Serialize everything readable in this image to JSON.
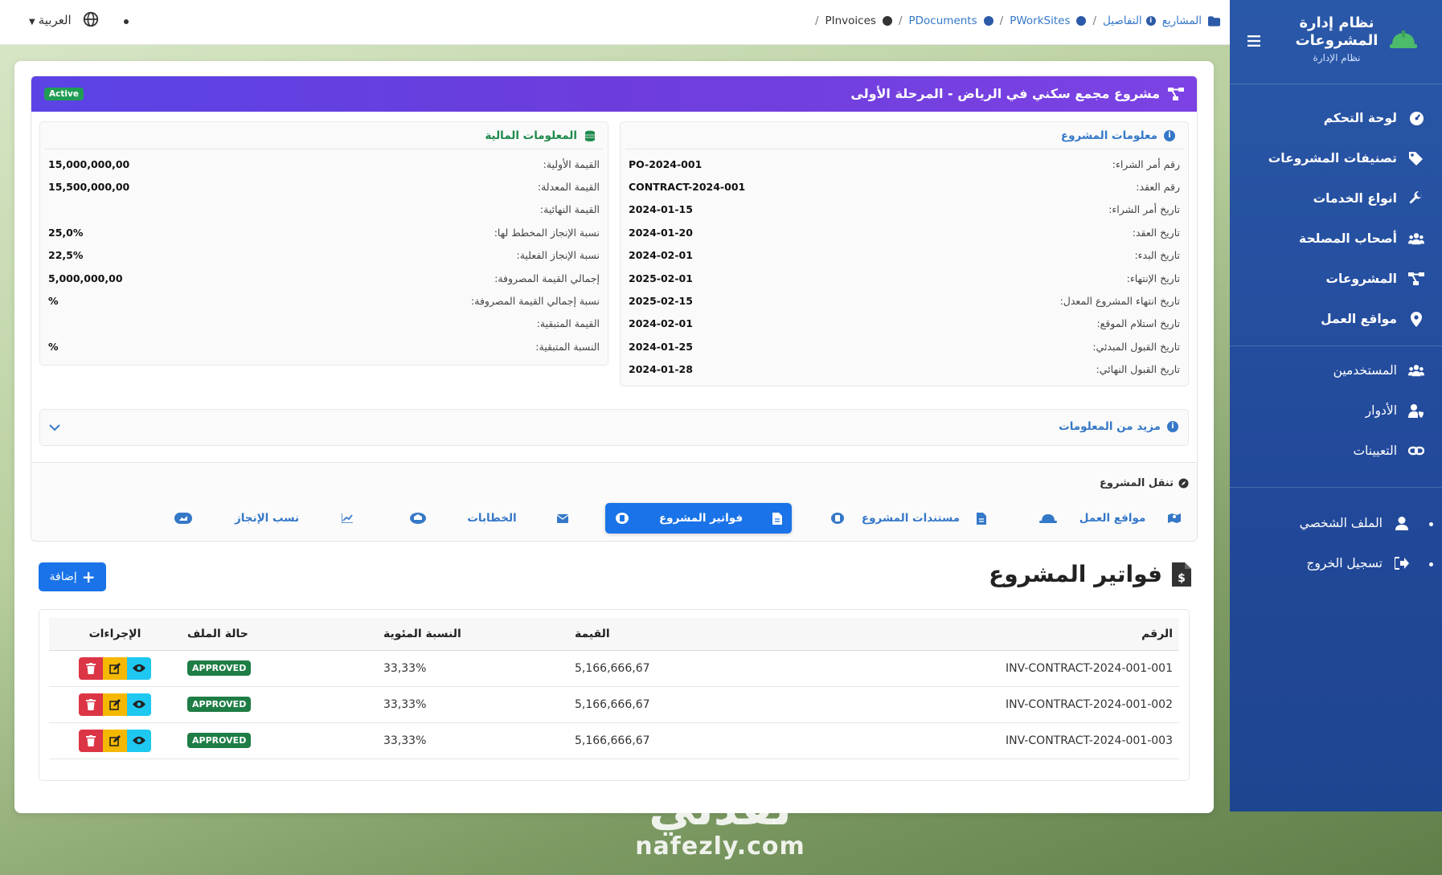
{
  "topbar": {
    "language": "العربية",
    "breadcrumb": [
      {
        "label": "المشاريع"
      },
      {
        "label": "التفاصيل"
      },
      {
        "label": "PWorkSites"
      },
      {
        "label": "PDocuments"
      },
      {
        "label": "PInvoices"
      }
    ]
  },
  "sidebar": {
    "brand_title_1": "نظام إدارة",
    "brand_title_2": "المشروعات",
    "brand_sub": "نظام الإدارة",
    "items": [
      {
        "label": "لوحة التحكم",
        "icon": "gauge-icon"
      },
      {
        "label": "تصنيفات المشروعات",
        "icon": "tags-icon"
      },
      {
        "label": "انواع الخدمات",
        "icon": "wrench-icon"
      },
      {
        "label": "أصحاب المصلحة",
        "icon": "users-icon"
      },
      {
        "label": "المشروعات",
        "icon": "project-diagram-icon"
      },
      {
        "label": "مواقع العمل",
        "icon": "map-pin-icon"
      },
      {
        "label": "المستخدمين",
        "icon": "users-icon"
      },
      {
        "label": "الأدوار",
        "icon": "user-shield-icon"
      },
      {
        "label": "التعيينات",
        "icon": "link-icon"
      }
    ],
    "profile": "الملف الشخصي",
    "logout": "تسجيل الخروج"
  },
  "project": {
    "title": "مشروع مجمع سكني في الرياض - المرحلة الأولى",
    "status": "Active",
    "info_header": "معلومات المشروع",
    "info": [
      {
        "k": "رقم أمر الشراء:",
        "v": "PO-2024-001"
      },
      {
        "k": "رقم العقد:",
        "v": "CONTRACT-2024-001"
      },
      {
        "k": "تاريخ أمر الشراء:",
        "v": "2024-01-15"
      },
      {
        "k": "تاريخ العقد:",
        "v": "2024-01-20"
      },
      {
        "k": "تاريخ البدء:",
        "v": "2024-02-01"
      },
      {
        "k": "تاريخ الإنتهاء:",
        "v": "2025-02-01"
      },
      {
        "k": "تاريخ انتهاء المشروع المعدل:",
        "v": "2025-02-15"
      },
      {
        "k": "تاريخ استلام الموقع:",
        "v": "2024-02-01"
      },
      {
        "k": "تاريخ القبول المبدئي:",
        "v": "2024-01-25"
      },
      {
        "k": "تاريخ القبول النهائي:",
        "v": "2024-01-28"
      }
    ],
    "fin_header": "المعلومات المالية",
    "financial": [
      {
        "k": "القيمة الأولية:",
        "v": "15,000,000,00"
      },
      {
        "k": "القيمة المعدلة:",
        "v": "15,500,000,00"
      },
      {
        "k": "القيمة النهائية:",
        "v": ""
      },
      {
        "k": "نسبة الإنجاز المخطط لها:",
        "v": "25,0%"
      },
      {
        "k": "نسبة الإنجاز الفعلية:",
        "v": "22,5%"
      },
      {
        "k": "إجمالي القيمة المصروفة:",
        "v": "5,000,000,00"
      },
      {
        "k": "نسبة إجمالي القيمة المصروفة:",
        "v": "%"
      },
      {
        "k": "القيمة المتبقية:",
        "v": ""
      },
      {
        "k": "النسبة المتبقية:",
        "v": "%"
      }
    ],
    "more_info": "مزيد من المعلومات",
    "nav_label": "تنقل المشروع",
    "nav": [
      {
        "label": "مواقع العمل"
      },
      {
        "label": "مستندات المشروع"
      },
      {
        "label": "فواتير المشروع"
      },
      {
        "label": "الخطابات"
      },
      {
        "label": "نسب الإنجاز"
      }
    ]
  },
  "invoices": {
    "title": "فواتير المشروع",
    "add_label": "إضافة",
    "columns": [
      "الرقم",
      "القيمة",
      "النسبة المئوية",
      "حالة الملف",
      "الإجراءات"
    ],
    "rows": [
      {
        "number": "INV-CONTRACT-2024-001-001",
        "value": "5,166,666,67",
        "percent": "33,33%",
        "status": "APPROVED"
      },
      {
        "number": "INV-CONTRACT-2024-001-002",
        "value": "5,166,666,67",
        "percent": "33,33%",
        "status": "APPROVED"
      },
      {
        "number": "INV-CONTRACT-2024-001-003",
        "value": "5,166,666,67",
        "percent": "33,33%",
        "status": "APPROVED"
      }
    ]
  },
  "watermark": {
    "brand": "نفذلي",
    "url": "nafezly.com"
  }
}
